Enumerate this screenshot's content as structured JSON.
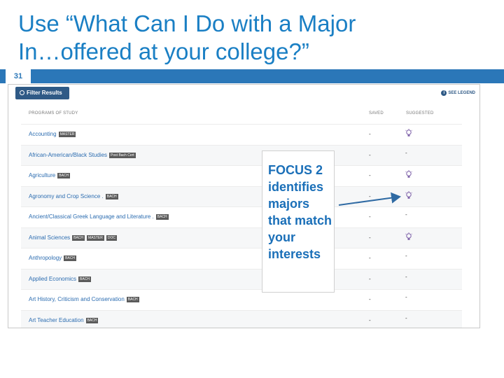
{
  "slide": {
    "title_line1": "Use “What Can I Do with a Major",
    "title_line2": "In…offered at your college?”",
    "number": "31"
  },
  "app": {
    "filter_button_label": "Filter Results",
    "see_legend_label": "SEE LEGEND",
    "columns": {
      "programs": "PROGRAMS OF STUDY",
      "saved": "SAVED",
      "suggested": "SUGGESTED"
    },
    "rows": [
      {
        "name": "Accounting",
        "badges": [
          "MASTER"
        ],
        "saved": "-",
        "suggested": "bulb"
      },
      {
        "name": "African-American/Black Studies",
        "badges": [
          "Post Bach Cert"
        ],
        "saved": "-",
        "suggested": "-"
      },
      {
        "name": "Agriculture",
        "badges": [
          "BACH"
        ],
        "saved": "-",
        "suggested": "bulb"
      },
      {
        "name": "Agronomy and Crop Science .",
        "badges": [
          "BACH"
        ],
        "saved": "-",
        "suggested": "bulb"
      },
      {
        "name": "Ancient/Classical Greek Language and Literature .",
        "badges": [
          "BACH"
        ],
        "saved": "-",
        "suggested": "-"
      },
      {
        "name": "Animal Sciences",
        "badges": [
          "BACH",
          "MASTER",
          "DOC"
        ],
        "saved": "-",
        "suggested": "bulb"
      },
      {
        "name": "Anthropology",
        "badges": [
          "BACH"
        ],
        "saved": "-",
        "suggested": "-"
      },
      {
        "name": "Applied Economics",
        "badges": [
          "BACH"
        ],
        "saved": "-",
        "suggested": "-"
      },
      {
        "name": "Art History, Criticism and Conservation",
        "badges": [
          "BACH"
        ],
        "saved": "-",
        "suggested": "-"
      },
      {
        "name": "Art Teacher Education",
        "badges": [
          "BACH"
        ],
        "saved": "-",
        "suggested": "-"
      }
    ]
  },
  "callout": {
    "text": "FOCUS 2 identifies majors that match your interests"
  },
  "colors": {
    "accent": "#1a7fc4",
    "bar": "#2b77b8",
    "button": "#2f5a86",
    "bulb": "#7b5ea7",
    "arrow": "#2f6aa3"
  }
}
